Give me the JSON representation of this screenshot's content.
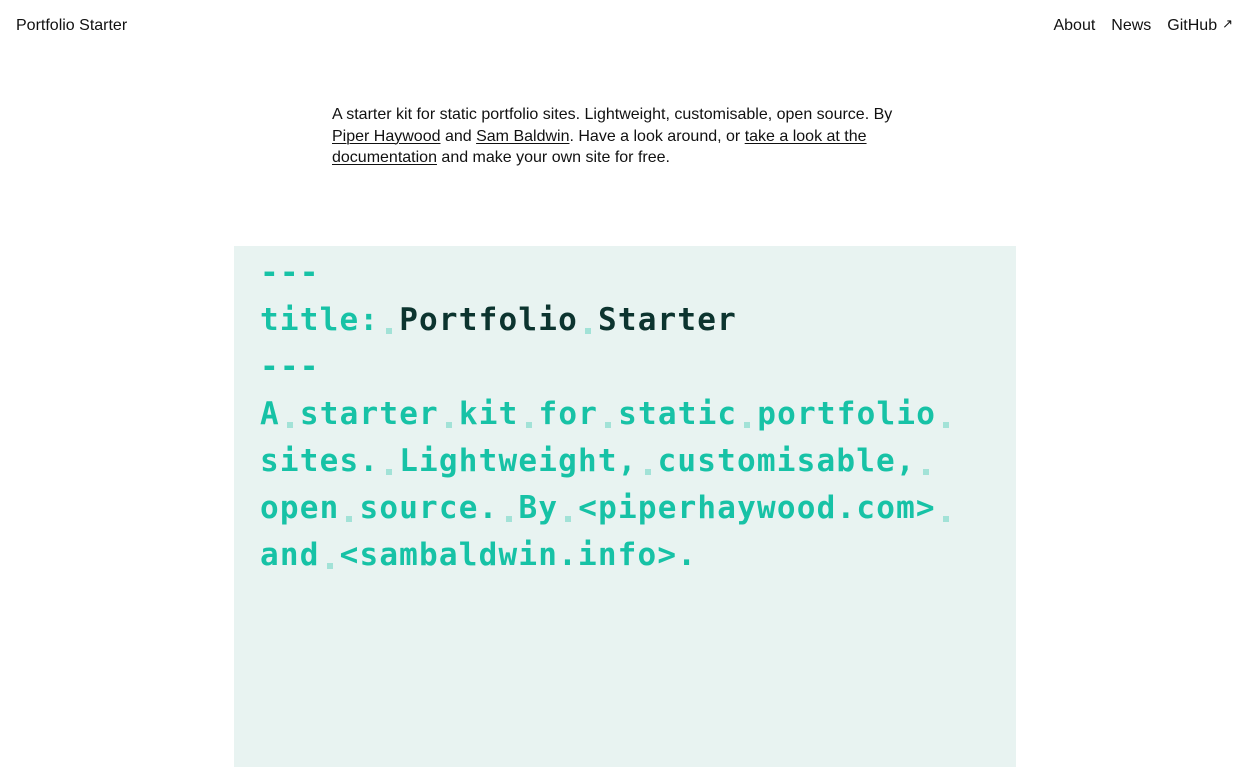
{
  "header": {
    "site_title": "Portfolio Starter",
    "nav": [
      {
        "label": "About"
      },
      {
        "label": "News"
      },
      {
        "label": "GitHub",
        "external_icon": "↗"
      }
    ]
  },
  "intro": {
    "part1": "A starter kit for static portfolio sites. Lightweight, customisable, open source. By ",
    "link1": "Piper Haywood",
    "part2": " and ",
    "link2": "Sam Baldwin",
    "part3": ". Have a look around, or ",
    "link3": "take a look at the documentation",
    "part4": " and make your own site for free."
  },
  "code_panel": {
    "lines": [
      {
        "words": [
          "---"
        ]
      },
      {
        "key": "title:",
        "value_words": [
          "Portfolio",
          "Starter"
        ]
      },
      {
        "words": [
          "---"
        ]
      },
      {
        "words": [
          "A",
          "starter",
          "kit",
          "for",
          "static",
          "portfolio"
        ],
        "trailing_space": true
      },
      {
        "words": [
          "sites.",
          "Lightweight,",
          "customisable,"
        ],
        "trailing_space": true
      },
      {
        "words": [
          "open",
          "source.",
          "By",
          "<piperhaywood.com>"
        ],
        "trailing_space": true
      },
      {
        "words": [
          "and",
          "<sambaldwin.info>."
        ]
      }
    ]
  }
}
